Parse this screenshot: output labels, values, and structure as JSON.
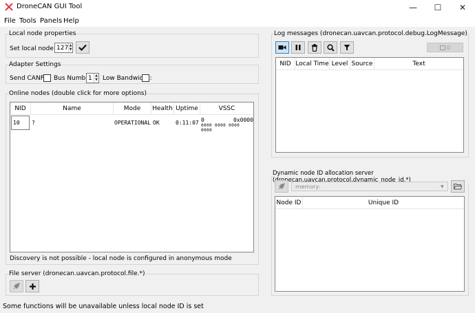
{
  "window": {
    "title": "DroneCAN GUI Tool",
    "minimize_glyph": "—",
    "maximize_glyph": "☐",
    "close_glyph": "✕",
    "accent": "#e0393e"
  },
  "menu": [
    "File",
    "Tools",
    "Panels",
    "Help"
  ],
  "local_node": {
    "title": "Local node properties",
    "set_label": "Set local node ID:",
    "node_id": "127"
  },
  "adapter": {
    "title": "Adapter Settings",
    "send_canfd_label": "Send CANFD:",
    "bus_number_label": "Bus Number:",
    "bus_number": "1",
    "low_bandwidth_label": "Low Bandwidth:"
  },
  "online_nodes": {
    "title": "Online nodes (double click for more options)",
    "columns": [
      "NID",
      "Name",
      "Mode",
      "Health",
      "Uptime",
      "VSSC"
    ],
    "rows": [
      {
        "nid": "10",
        "name": "?",
        "mode": "OPERATIONAL",
        "health": "OK",
        "uptime": "0:11:07",
        "vssc_a": "0",
        "vssc_b": "0x0000",
        "vssc_sub": "0000 0000 0000 0000"
      }
    ],
    "discovery_note": "Discovery is not possible - local node is configured in anonymous mode"
  },
  "file_server": {
    "title": "File server (dronecan.uavcan.protocol.file.*)"
  },
  "log": {
    "title": "Log messages (dronecan.uavcan.protocol.debug.LogMessage)",
    "count": "0",
    "columns": [
      "NID",
      "Local Time",
      "Level",
      "Source",
      "Text"
    ]
  },
  "dyn_alloc": {
    "title": "Dynamic node ID allocation server (dronecan.uavcan.protocol.dynamic_node_id.*)",
    "db_placeholder": ":memory:",
    "columns": [
      "Node ID",
      "Unique ID"
    ]
  },
  "status_bar": "Some functions will be unavailable unless local node ID is set"
}
